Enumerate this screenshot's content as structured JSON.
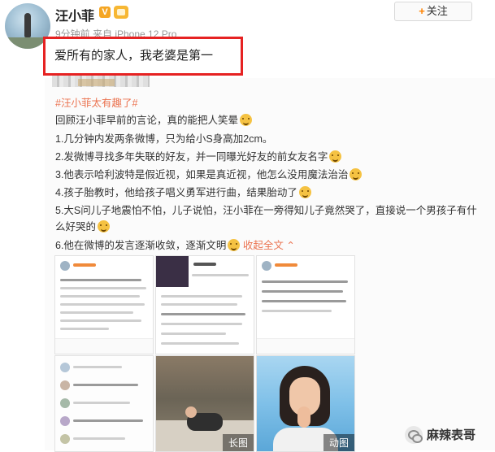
{
  "post": {
    "username": "汪小菲",
    "verified_badge": "V",
    "meta": "9分钟前 来自 iPhone 12 Pro",
    "follow_label": "关注",
    "follow_plus": "+"
  },
  "caption": "爱所有的家人，我老婆是第一",
  "article": {
    "hashtag": "#汪小菲太有趣了#",
    "intro": "回顾汪小菲早前的言论，真的能把人笑晕",
    "items": [
      "1.几分钟内发两条微博，只为给小S身高加2cm。",
      "2.发微博寻找多年失联的好友，并一同曝光好友的前女友名字",
      "3.他表示哈利波特是假近视，如果是真近视，他怎么没用魔法治治",
      "4.孩子胎教时，他给孩子唱义勇军进行曲，结果胎动了",
      "5.大S问儿子地震怕不怕，儿子说怕，汪小菲在一旁得知儿子竟然哭了，直接说一个男孩子有什",
      "么好哭的",
      "6.他在微博的发言逐渐收敛，逐渐文明"
    ],
    "collapse_label": "收起全文 ⌃"
  },
  "thumbnails": [
    {
      "label": "汪小菲",
      "tag": ""
    },
    {
      "label": "汪小菲",
      "tag": ""
    },
    {
      "label": "汪小菲",
      "tag": ""
    },
    {
      "label": "",
      "tag": ""
    },
    {
      "label": "",
      "tag": "长图"
    },
    {
      "label": "",
      "tag": "动图"
    }
  ],
  "watermark": "麻辣表哥"
}
